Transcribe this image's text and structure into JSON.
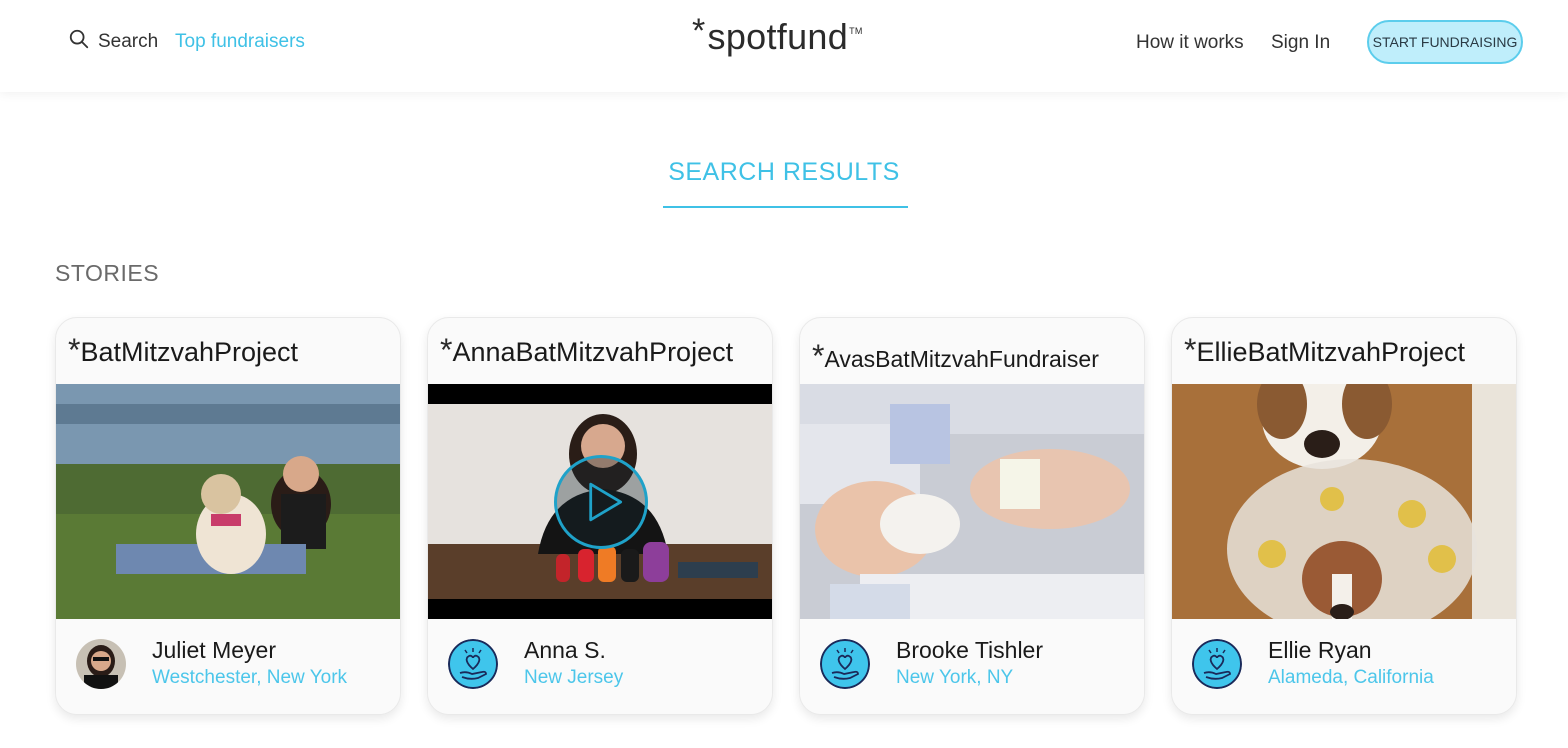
{
  "header": {
    "search_label": "Search",
    "top_fundraisers_label": "Top fundraisers",
    "logo_star": "*",
    "logo_text": "spotfund",
    "logo_tm": "TM",
    "how_it_works_label": "How it works",
    "sign_in_label": "Sign In",
    "start_button_label": "START FUNDRAISING"
  },
  "main": {
    "results_title": "SEARCH RESULTS",
    "stories_label": "STORIES"
  },
  "cards": [
    {
      "title": "BatMitzvahProject",
      "name": "Juliet Meyer",
      "location": "Westchester, New York"
    },
    {
      "title": "AnnaBatMitzvahProject",
      "name": "Anna S.",
      "location": "New Jersey"
    },
    {
      "title": "AvasBatMitzvahFundraiser",
      "name": "Brooke Tishler",
      "location": "New York, NY"
    },
    {
      "title": "EllieBatMitzvahProject",
      "name": "Ellie Ryan",
      "location": "Alameda, California"
    }
  ],
  "icons": {
    "search": "search-icon",
    "play": "play-icon",
    "avatar_default": "heart-hand-icon"
  },
  "colors": {
    "accent": "#3fc1e6",
    "button_bg": "#bfeefb"
  }
}
